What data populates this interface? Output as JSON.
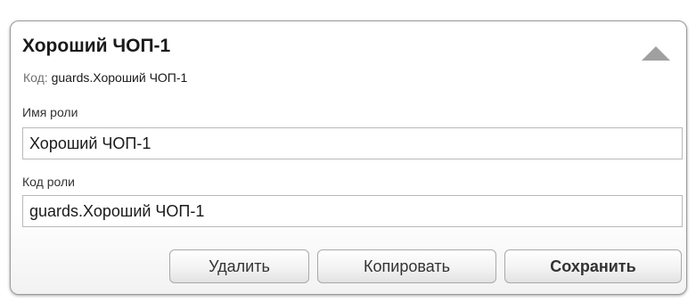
{
  "panel": {
    "title": "Хороший ЧОП-1",
    "code_label": "Код:",
    "code_value": "guards.Хороший ЧОП-1",
    "collapse_icon": "triangle-up-icon",
    "collapse_color": "#a0a0a0"
  },
  "fields": {
    "role_name": {
      "label": "Имя роли",
      "value": "Хороший ЧОП-1"
    },
    "role_code": {
      "label": "Код роли",
      "value": "guards.Хороший ЧОП-1"
    }
  },
  "buttons": {
    "delete": "Удалить",
    "copy": "Копировать",
    "save": "Сохранить"
  }
}
